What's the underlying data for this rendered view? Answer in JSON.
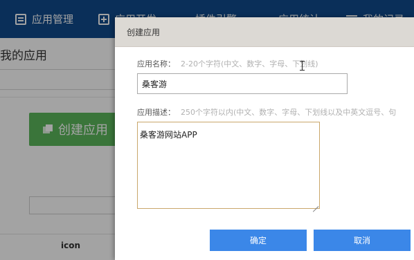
{
  "nav": {
    "items": [
      {
        "label": "应用管理",
        "icon": "app-grid-icon"
      },
      {
        "label": "应用开发",
        "icon": "plus-square-icon"
      },
      {
        "label": "插件引擎",
        "icon": "dash-icon"
      },
      {
        "label": "应用统计",
        "icon": "dash-icon"
      },
      {
        "label": "我的记录",
        "icon": "list-icon"
      }
    ],
    "colors": {
      "background": "#104a8c",
      "text": "#ffffff"
    }
  },
  "background_page": {
    "title": "我的应用",
    "create_button_label": "创建应用",
    "table_header_icon": "icon",
    "colors": {
      "create_button": "#5cb85c"
    }
  },
  "dialog": {
    "title": "创建应用",
    "name_field": {
      "label": "应用名称：",
      "hint": "2-20个字符(中文、数字、字母、下划线)",
      "value": "桑客游"
    },
    "desc_field": {
      "label": "应用描述：",
      "hint": "250个字符以内(中文、数字、字母、下划线以及中英文逗号、句",
      "value": "桑客游网站APP"
    },
    "confirm_label": "确定",
    "cancel_label": "取消",
    "colors": {
      "button": "#3b87e8",
      "textarea_focus_border": "#c9a66a",
      "header": "#dcd9d4"
    }
  }
}
